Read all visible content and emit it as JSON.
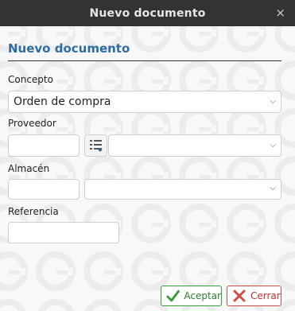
{
  "window": {
    "title": "Nuevo documento",
    "close_glyph": "×"
  },
  "form": {
    "heading": "Nuevo documento",
    "concepto": {
      "label": "Concepto",
      "value": "Orden de compra"
    },
    "proveedor": {
      "label": "Proveedor",
      "code_value": "",
      "name_value": ""
    },
    "almacen": {
      "label": "Almacén",
      "code_value": "",
      "name_value": ""
    },
    "referencia": {
      "label": "Referencia",
      "value": ""
    }
  },
  "buttons": {
    "accept": "Aceptar",
    "close": "Cerrar"
  },
  "colors": {
    "heading": "#2e6da4",
    "accept": "#3c9a3c",
    "cancel": "#d24a4a",
    "titlebar": "#333333"
  }
}
